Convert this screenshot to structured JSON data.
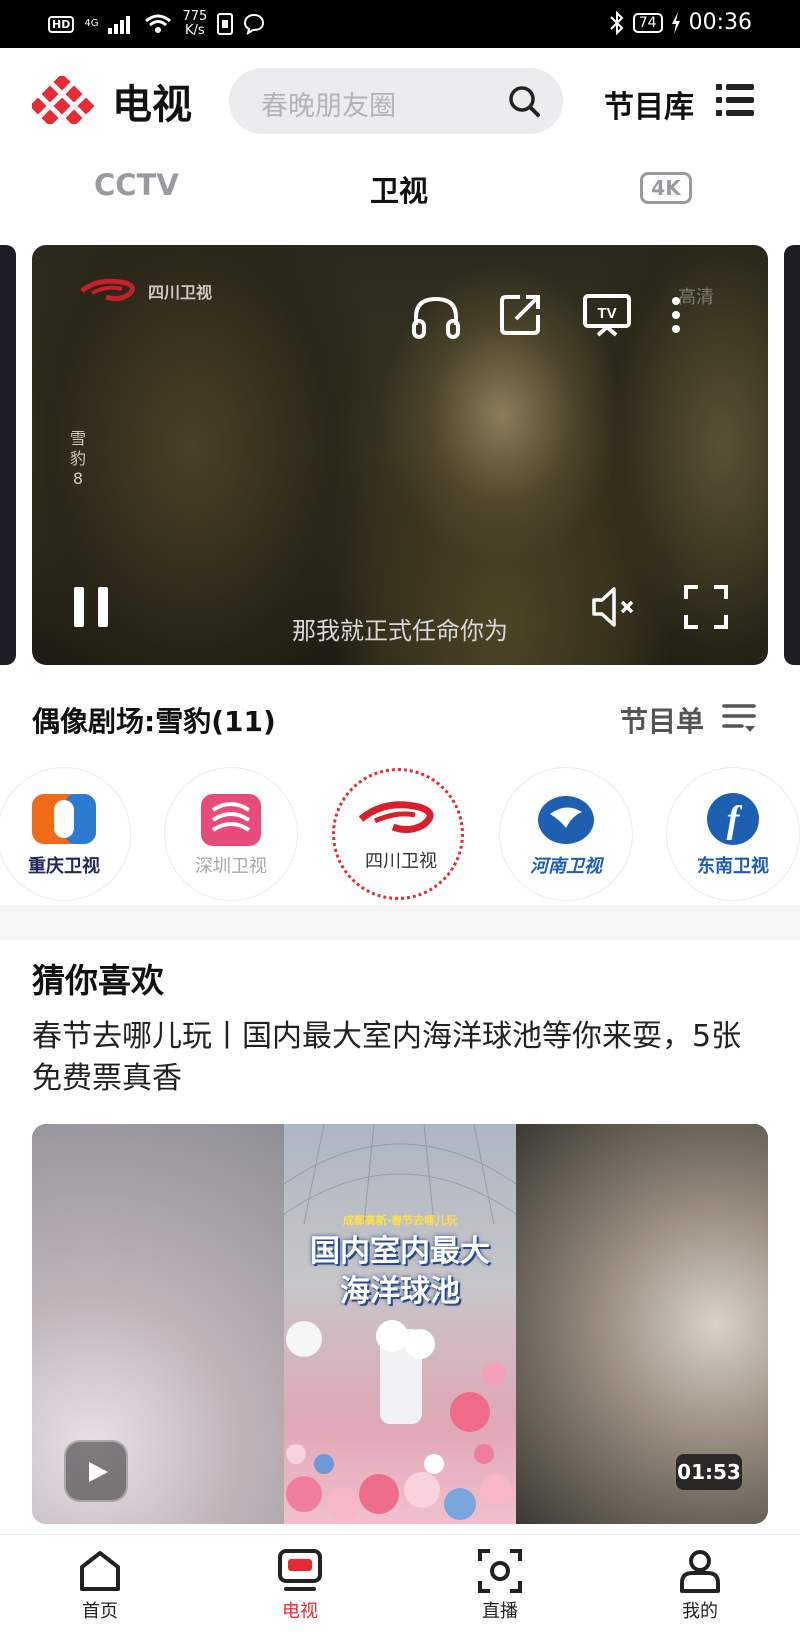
{
  "status_bar": {
    "hd": "HD",
    "network": "4G",
    "speed_value": "775",
    "speed_unit": "K/s",
    "battery": "74",
    "time": "00:36"
  },
  "header": {
    "app_title": "电视",
    "search_placeholder": "春晚朋友圈",
    "program_library": "节目库"
  },
  "tabs": [
    {
      "label": "CCTV",
      "active": false
    },
    {
      "label": "卫视",
      "active": true
    },
    {
      "label": "4K",
      "active": false
    }
  ],
  "player": {
    "channel_logo_text": "四川卫视",
    "side_text": "雪豹",
    "side_number": "8",
    "quality_label": "高清",
    "subtitle": "那我就正式任命你为",
    "state": "playing",
    "muted": true
  },
  "program": {
    "title": "偶像剧场:雪豹(11)",
    "schedule_label": "节目单"
  },
  "channels": [
    {
      "name": "重庆卫视",
      "color": "#1f2a5a",
      "active": false
    },
    {
      "name": "深圳卫视",
      "color": "#b5b5b5",
      "active": false
    },
    {
      "name": "四川卫视",
      "color": "#333333",
      "active": true
    },
    {
      "name": "河南卫视",
      "color": "#1d5fb0",
      "active": false
    },
    {
      "name": "东南卫视",
      "color": "#1d5fb0",
      "active": false
    }
  ],
  "recommend": {
    "section_title": "猜你喜欢",
    "item_title": "春节去哪儿玩丨国内最大室内海洋球池等你来耍，5张免费票真香",
    "thumb_banner": "成都高新·春节去哪儿玩",
    "thumb_caption_line1": "国内室内最大",
    "thumb_caption_line2": "海洋球池",
    "duration": "01:53"
  },
  "bottom_nav": [
    {
      "label": "首页",
      "icon": "home-icon",
      "active": false
    },
    {
      "label": "电视",
      "icon": "tv-icon",
      "active": true
    },
    {
      "label": "直播",
      "icon": "live-icon",
      "active": false
    },
    {
      "label": "我的",
      "icon": "profile-icon",
      "active": false
    }
  ],
  "colors": {
    "accent": "#e62a36",
    "search_bg": "#ececee",
    "text_dark": "#111111",
    "text_muted": "#9a9a9e"
  }
}
